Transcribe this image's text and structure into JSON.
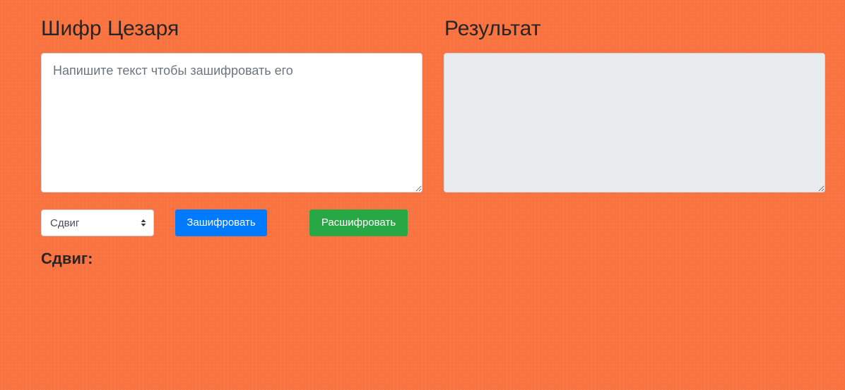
{
  "left": {
    "title": "Шифр Цезаря",
    "input_placeholder": "Напишите текст чтобы зашифровать его",
    "input_value": ""
  },
  "right": {
    "title": "Результат",
    "result_value": ""
  },
  "controls": {
    "shift_select_value": "Сдвиг",
    "encrypt_label": "Зашифровать",
    "decrypt_label": "Расшифровать"
  },
  "shift_display": {
    "label": "Сдвиг:"
  },
  "colors": {
    "background": "#f87340",
    "encrypt_button": "#007bff",
    "decrypt_button": "#28a745",
    "result_background": "#e9ecef"
  },
  "icons": {
    "select_arrows": "sort-arrows-icon"
  }
}
